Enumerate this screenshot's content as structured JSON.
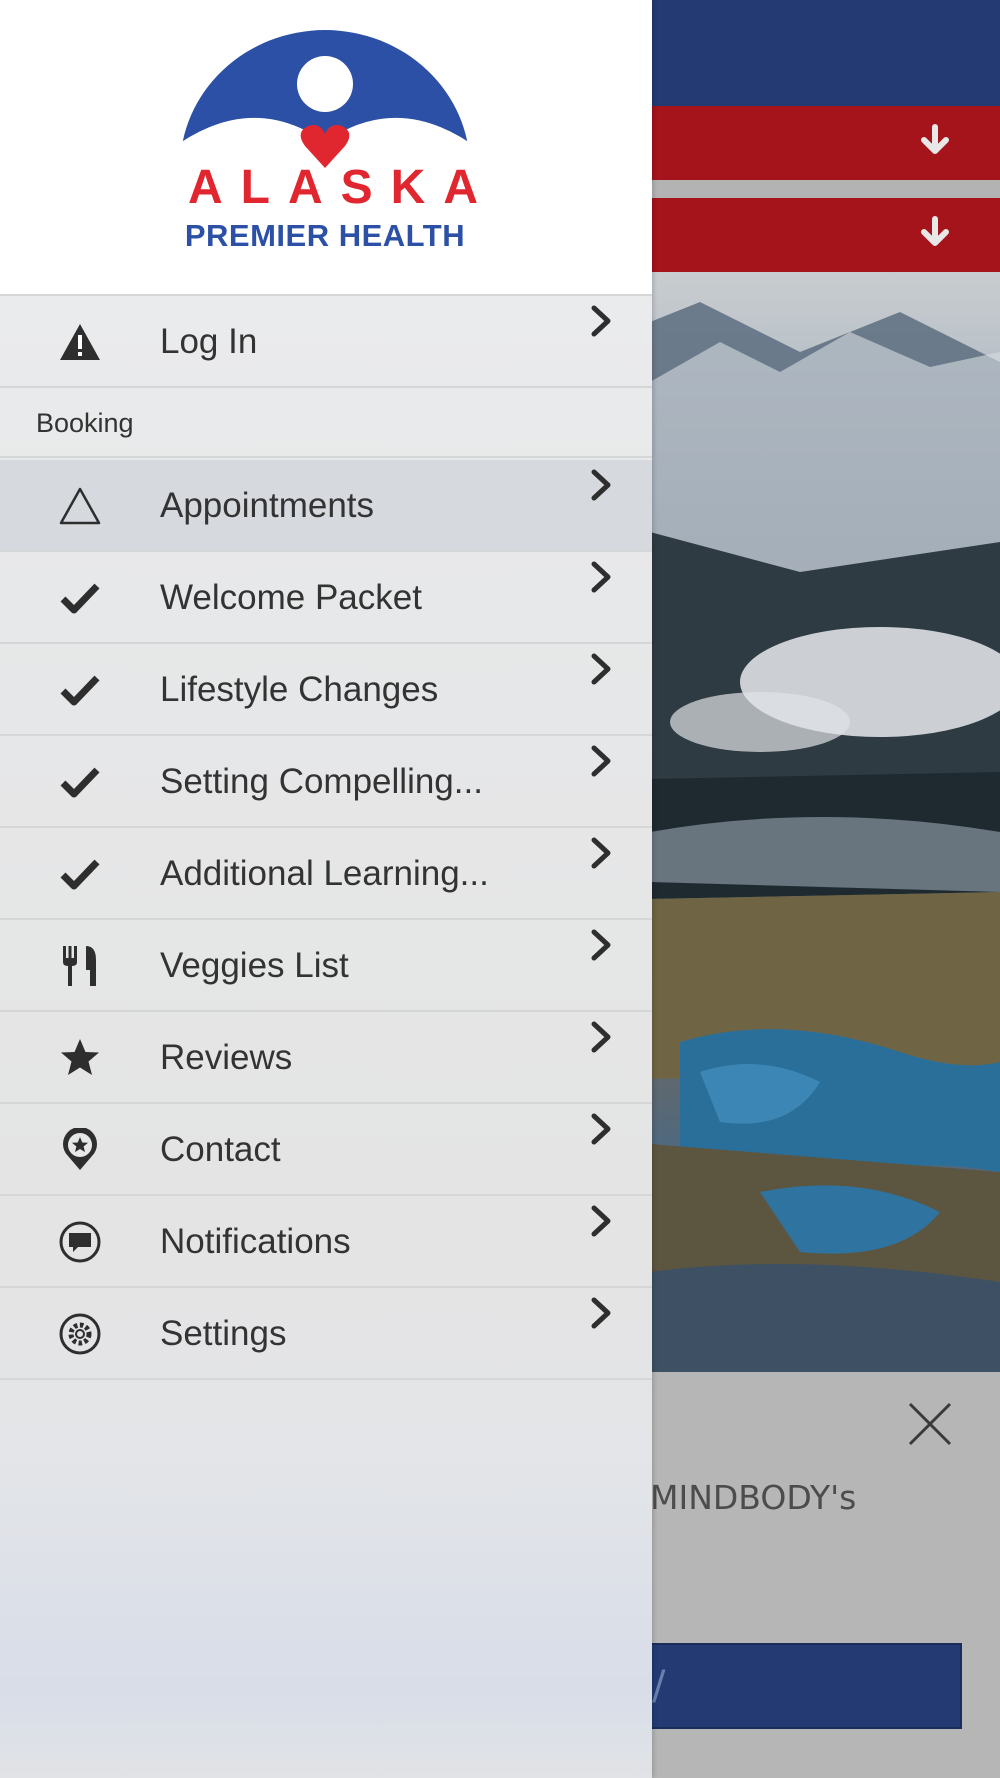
{
  "background": {
    "colors": {
      "header": "#233a73",
      "accent_bar": "#a5131b",
      "button": "#233a73"
    },
    "bar_icon": "arrow-down-icon",
    "close_icon": "close-icon",
    "text_fragment": "MINDBODY's",
    "button_fragment": "/"
  },
  "drawer": {
    "logo": {
      "name": "ALASKA",
      "subtitle": "PREMIER HEALTH",
      "colors": {
        "blue": "#2c50a6",
        "red": "#e0262e"
      }
    },
    "login": {
      "label": "Log In",
      "icon": "warning-icon"
    },
    "section_title": "Booking",
    "items": [
      {
        "label": "Appointments",
        "icon": "triangle-outline-icon"
      },
      {
        "label": "Welcome Packet",
        "icon": "check-icon"
      },
      {
        "label": "Lifestyle Changes",
        "icon": "check-icon"
      },
      {
        "label": "Setting Compelling...",
        "icon": "check-icon"
      },
      {
        "label": "Additional Learning...",
        "icon": "check-icon"
      },
      {
        "label": "Veggies List",
        "icon": "fork-knife-icon"
      },
      {
        "label": "Reviews",
        "icon": "star-icon"
      },
      {
        "label": "Contact",
        "icon": "map-pin-star-icon"
      },
      {
        "label": "Notifications",
        "icon": "chat-bubble-icon"
      },
      {
        "label": "Settings",
        "icon": "gear-icon"
      }
    ],
    "chevron_icon": "chevron-right-icon"
  }
}
